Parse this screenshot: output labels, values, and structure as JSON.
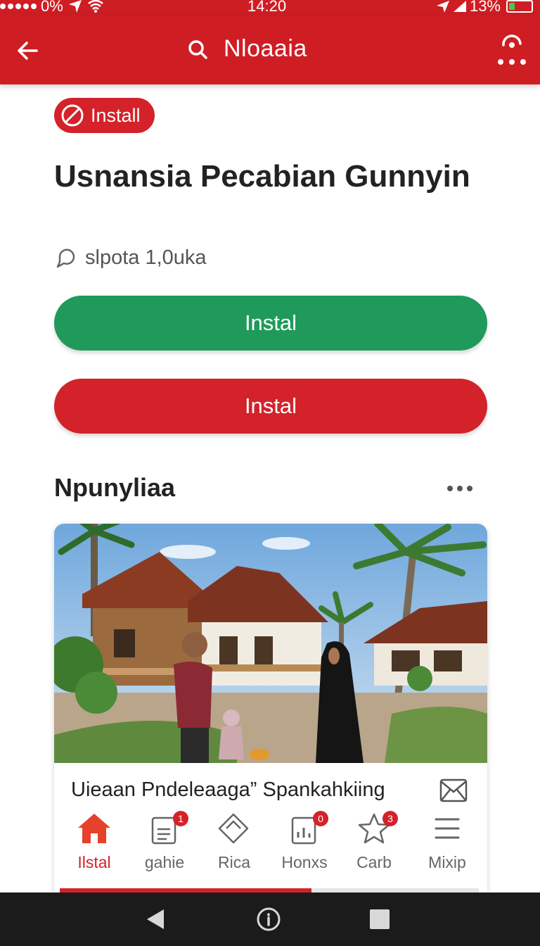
{
  "status_bar": {
    "signal_text": "0%",
    "time": "14:20",
    "battery_text": "13%"
  },
  "app_bar": {
    "search_title": "Nloaaia"
  },
  "content": {
    "chip_label": "Install",
    "headline": "Usnansia Pecabian Gunnyin",
    "meta_text": "slpota 1,0uka",
    "primary_button": "Instal",
    "secondary_button": "Instal",
    "section_title": "Npunyliaa"
  },
  "card": {
    "caption": "Uieaan Pndeleaaga” Spankahkiing",
    "tabs": [
      {
        "label": "Ilstal",
        "icon": "home-icon",
        "badge": ""
      },
      {
        "label": "gahie",
        "icon": "book-icon",
        "badge": "1"
      },
      {
        "label": "Rica",
        "icon": "tag-icon",
        "badge": ""
      },
      {
        "label": "Honxs",
        "icon": "chart-card-icon",
        "badge": "0"
      },
      {
        "label": "Carb",
        "icon": "star-icon",
        "badge": "3"
      },
      {
        "label": "Mixip",
        "icon": "menu-icon",
        "badge": ""
      }
    ],
    "progress_percent": 60
  },
  "colors": {
    "brand_red": "#cf1d24",
    "install_green": "#1f9a5b",
    "nav_dark": "#1b1b1b"
  }
}
